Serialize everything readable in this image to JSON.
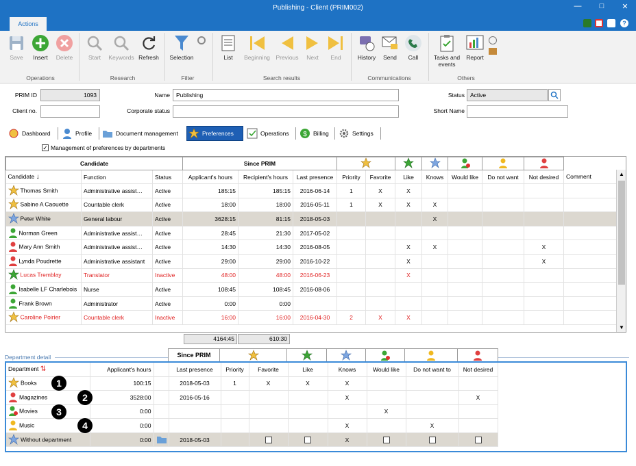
{
  "window": {
    "title": "Publishing - Client (PRIM002)"
  },
  "ribbon": {
    "tab": "Actions",
    "groups": [
      "Operations",
      "Research",
      "Filter",
      "Search results",
      "Communications",
      "Others"
    ],
    "buttons": {
      "save": "Save",
      "insert": "Insert",
      "delete": "Delete",
      "start": "Start",
      "keywords": "Keywords",
      "refresh": "Refresh",
      "selection": "Selection",
      "list": "List",
      "beginning": "Beginning",
      "previous": "Previous",
      "next": "Next",
      "end": "End",
      "history": "History",
      "send": "Send",
      "call": "Call",
      "tasks": "Tasks and events",
      "report": "Report"
    }
  },
  "form": {
    "prim_id_label": "PRIM ID",
    "prim_id": "1093",
    "name_label": "Name",
    "name": "Publishing",
    "status_label": "Status",
    "status": "Active",
    "client_no_label": "Client no.",
    "client_no": "",
    "corporate_label": "Corporate status",
    "corporate": "",
    "short_name_label": "Short Name",
    "short_name": ""
  },
  "tabs": [
    "Dashboard",
    "Profile",
    "Document management",
    "Preferences",
    "Operations",
    "Billing",
    "Settings"
  ],
  "checkbox": {
    "label": "Management of preferences by departments",
    "checked": true
  },
  "candidates": {
    "group_candidate": "Candidate",
    "group_since": "Since PRIM",
    "columns": [
      "Candidate",
      "Function",
      "Status",
      "Applicant's hours",
      "Recipient's hours",
      "Last presence",
      "Priority",
      "Favorite",
      "Like",
      "Knows",
      "Would like",
      "Do not want",
      "Not desired",
      "Comment"
    ],
    "rows": [
      {
        "icon": "star-gold",
        "name": "Thomas Smith",
        "function": "Administrative assist…",
        "status": "Active",
        "app": "185:15",
        "rec": "185:15",
        "last": "2016-06-14",
        "priority": "1",
        "favorite": "X",
        "like": "X",
        "knows": "",
        "would": "",
        "notwant": "",
        "notdesired": "",
        "style": ""
      },
      {
        "icon": "star-gold",
        "name": "Sabine A Caouette",
        "function": "Countable clerk",
        "status": "Active",
        "app": "18:00",
        "rec": "18:00",
        "last": "2016-05-11",
        "priority": "1",
        "favorite": "X",
        "like": "X",
        "knows": "X",
        "would": "",
        "notwant": "",
        "notdesired": "",
        "style": ""
      },
      {
        "icon": "star-blue",
        "name": "Peter White",
        "function": "General labour",
        "status": "Active",
        "app": "3628:15",
        "rec": "81:15",
        "last": "2018-05-03",
        "priority": "",
        "favorite": "",
        "like": "",
        "knows": "X",
        "would": "",
        "notwant": "",
        "notdesired": "",
        "style": "hl"
      },
      {
        "icon": "person-green",
        "name": "Norman Green",
        "function": "Administrative assist…",
        "status": "Active",
        "app": "28:45",
        "rec": "21:30",
        "last": "2017-05-02",
        "priority": "",
        "favorite": "",
        "like": "",
        "knows": "",
        "would": "",
        "notwant": "",
        "notdesired": "",
        "style": ""
      },
      {
        "icon": "person-red",
        "name": "Mary Ann Smith",
        "function": "Administrative assist…",
        "status": "Active",
        "app": "14:30",
        "rec": "14:30",
        "last": "2016-08-05",
        "priority": "",
        "favorite": "",
        "like": "X",
        "knows": "X",
        "would": "",
        "notwant": "",
        "notdesired": "X",
        "style": ""
      },
      {
        "icon": "person-red",
        "name": "Lynda Poudrette",
        "function": "Administrative assistant",
        "status": "Active",
        "app": "29:00",
        "rec": "29:00",
        "last": "2016-10-22",
        "priority": "",
        "favorite": "",
        "like": "X",
        "knows": "",
        "would": "",
        "notwant": "",
        "notdesired": "X",
        "style": ""
      },
      {
        "icon": "star-green",
        "name": "Lucas Tremblay",
        "function": "Translator",
        "status": "Inactive",
        "app": "48:00",
        "rec": "48:00",
        "last": "2016-06-23",
        "priority": "",
        "favorite": "",
        "like": "X",
        "knows": "",
        "would": "",
        "notwant": "",
        "notdesired": "",
        "style": "red"
      },
      {
        "icon": "person-green",
        "name": "Isabelle LF Charlebois",
        "function": "Nurse",
        "status": "Active",
        "app": "108:45",
        "rec": "108:45",
        "last": "2016-08-06",
        "priority": "",
        "favorite": "",
        "like": "",
        "knows": "",
        "would": "",
        "notwant": "",
        "notdesired": "",
        "style": ""
      },
      {
        "icon": "person-green",
        "name": "Frank Brown",
        "function": "Administrator",
        "status": "Active",
        "app": "0:00",
        "rec": "0:00",
        "last": "",
        "priority": "",
        "favorite": "",
        "like": "",
        "knows": "",
        "would": "",
        "notwant": "",
        "notdesired": "",
        "style": ""
      },
      {
        "icon": "star-gold",
        "name": "Caroline Poirier",
        "function": "Countable clerk",
        "status": "Inactive",
        "app": "16:00",
        "rec": "16:00",
        "last": "2016-04-30",
        "priority": "2",
        "favorite": "X",
        "like": "X",
        "knows": "",
        "would": "",
        "notwant": "",
        "notdesired": "",
        "style": "red"
      }
    ],
    "totals": {
      "app": "4164:45",
      "rec": "610:30"
    }
  },
  "department": {
    "section_label": "Department detail",
    "group_since": "Since PRIM",
    "columns": [
      "Department",
      "Applicant's hours",
      "Last presence",
      "Priority",
      "Favorite",
      "Like",
      "Knows",
      "Would like",
      "Do not want to",
      "Not desired"
    ],
    "rows": [
      {
        "icon": "star-gold",
        "name": "Books",
        "hours": "100:15",
        "last": "2018-05-03",
        "priority": "1",
        "favorite": "X",
        "like": "X",
        "knows": "X",
        "would": "",
        "notwant": "",
        "notdesired": "",
        "badge": "1"
      },
      {
        "icon": "person-red",
        "name": "Magazines",
        "hours": "3528:00",
        "last": "2016-05-16",
        "priority": "",
        "favorite": "",
        "like": "",
        "knows": "X",
        "would": "",
        "notwant": "",
        "notdesired": "X",
        "badge": "2"
      },
      {
        "icon": "person-heart",
        "name": "Movies",
        "hours": "0:00",
        "last": "",
        "priority": "",
        "favorite": "",
        "like": "",
        "knows": "",
        "would": "X",
        "notwant": "",
        "notdesired": "",
        "badge": "3"
      },
      {
        "icon": "person-gold",
        "name": "Music",
        "hours": "0:00",
        "last": "",
        "priority": "",
        "favorite": "",
        "like": "",
        "knows": "X",
        "would": "",
        "notwant": "X",
        "notdesired": "",
        "badge": "4"
      },
      {
        "icon": "star-blue",
        "name": "Without department",
        "hours": "0:00",
        "last": "2018-05-03",
        "priority": "",
        "favorite": "box",
        "like": "box",
        "knows": "X",
        "would": "box",
        "notwant": "box",
        "notdesired": "box",
        "badge": ""
      }
    ]
  },
  "colors": {
    "accent": "#1e72c4",
    "selected_tab": "#1e5fb4",
    "highlight_row": "#dcd8d0",
    "inactive": "#e02020"
  }
}
